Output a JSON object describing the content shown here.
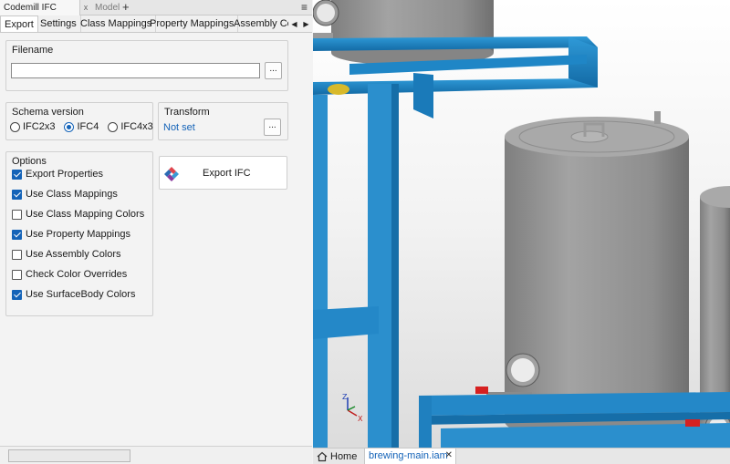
{
  "panel": {
    "title_tab": "Codemill IFC Exporter",
    "model_tab": "Model",
    "close_glyph": "x",
    "add_glyph": "+",
    "menu_glyph": "≡"
  },
  "tabs": [
    {
      "label": "Export",
      "active": true
    },
    {
      "label": "Settings"
    },
    {
      "label": "Class Mappings"
    },
    {
      "label": "Property Mappings"
    },
    {
      "label": "Assembly Co"
    }
  ],
  "tab_nav": {
    "prev": "◀",
    "next": "▶"
  },
  "filename": {
    "title": "Filename",
    "value": "",
    "browse_label": "..."
  },
  "schema": {
    "title": "Schema version",
    "options": [
      "IFC2x3",
      "IFC4",
      "IFC4x3"
    ],
    "selected": "IFC4"
  },
  "transform": {
    "title": "Transform",
    "value": "Not set",
    "browse_label": "..."
  },
  "options": {
    "title": "Options",
    "items": [
      {
        "label": "Export Properties",
        "checked": true
      },
      {
        "label": "Use Class Mappings",
        "checked": true
      },
      {
        "label": "Use Class Mapping Colors",
        "checked": false
      },
      {
        "label": "Use Property Mappings",
        "checked": true
      },
      {
        "label": "Use Assembly Colors",
        "checked": false
      },
      {
        "label": "Check Color Overrides",
        "checked": false
      },
      {
        "label": "Use SurfaceBody Colors",
        "checked": true
      }
    ]
  },
  "export_button": {
    "label": "Export IFC",
    "icon": "ifc-logo-icon"
  },
  "document_tabs": {
    "home": "Home",
    "active_doc": "brewing-main.iam",
    "close_glyph": "✕"
  },
  "colors": {
    "accent": "#1463b8",
    "frame_blue": "#1a82c4",
    "tank_gray": "#8f8f8f"
  }
}
